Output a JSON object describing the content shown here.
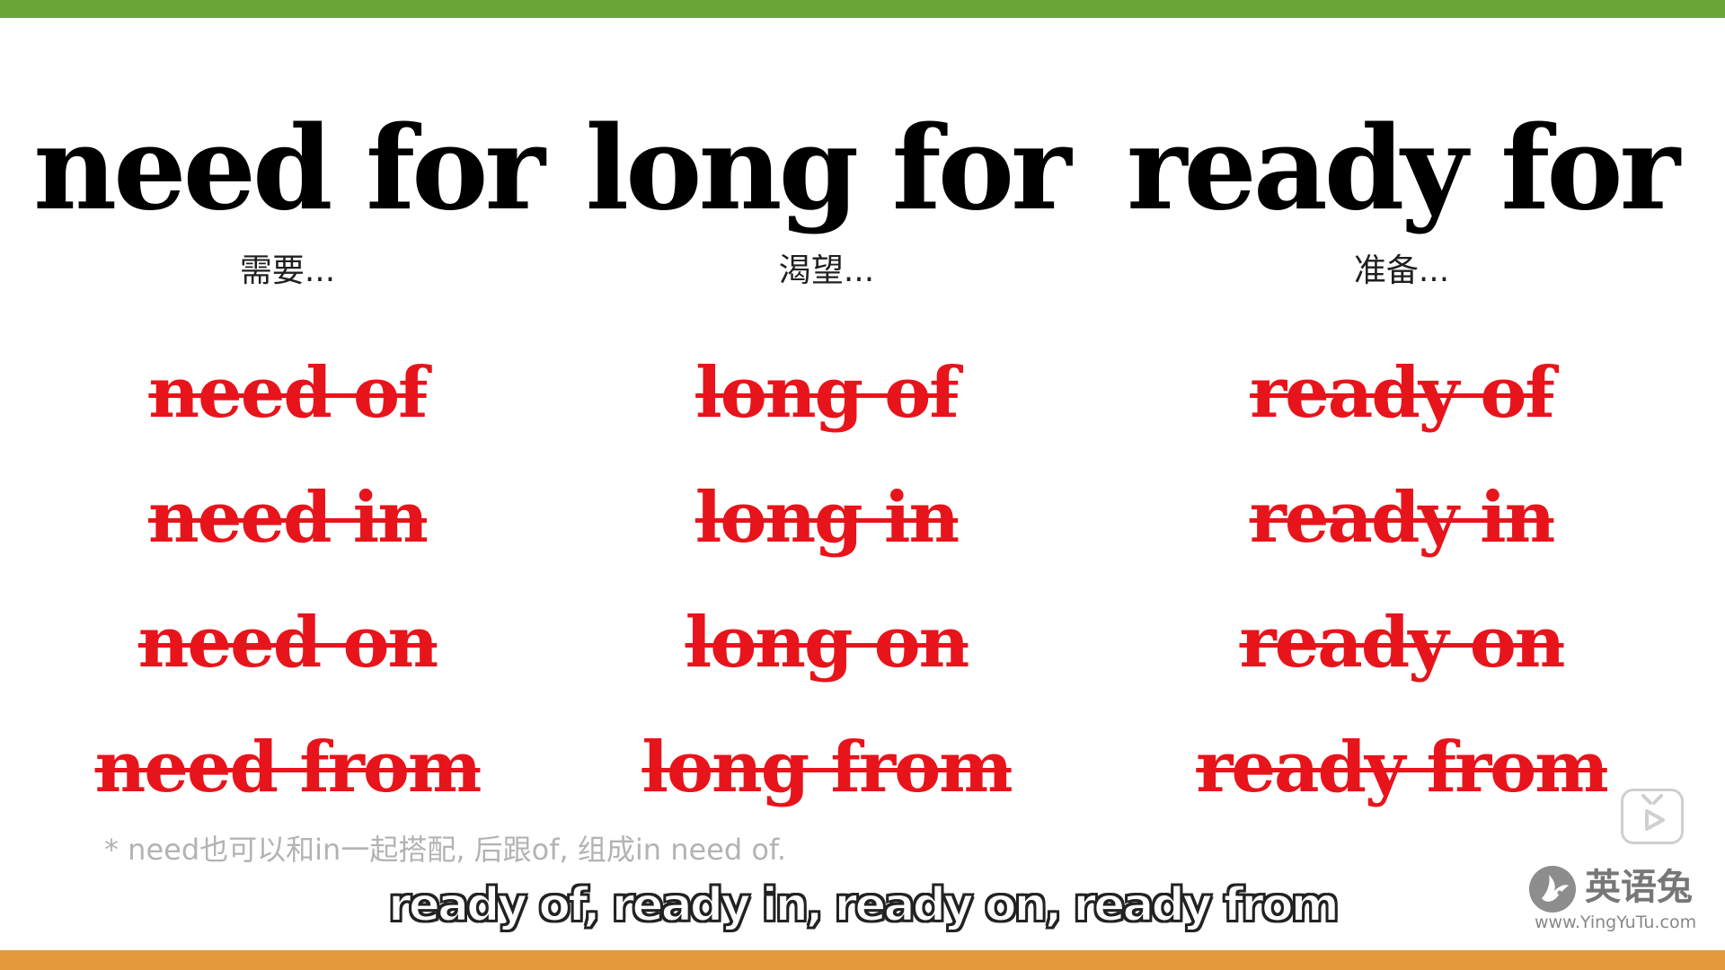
{
  "colors": {
    "top_bar": "#6aa637",
    "bottom_bar": "#e6993c",
    "wrong_text": "#e8141b"
  },
  "columns": [
    {
      "phrase": "need for",
      "meaning": "需要...",
      "wrong": [
        "need of",
        "need in",
        "need on",
        "need from"
      ]
    },
    {
      "phrase": "long for",
      "meaning": "渴望...",
      "wrong": [
        "long of",
        "long in",
        "long on",
        "long from"
      ]
    },
    {
      "phrase": "ready for",
      "meaning": "准备...",
      "wrong": [
        "ready of",
        "ready in",
        "ready on",
        "ready from"
      ]
    }
  ],
  "footnote": "* need也可以和in一起搭配, 后跟of, 组成in need of.",
  "subtitle": "ready of, ready in, ready on, ready from",
  "watermark": {
    "name": "英语兔",
    "url": "www.YingYuTu.com",
    "play_icon": "play-icon",
    "logo_icon": "rabbit-logo-icon"
  }
}
